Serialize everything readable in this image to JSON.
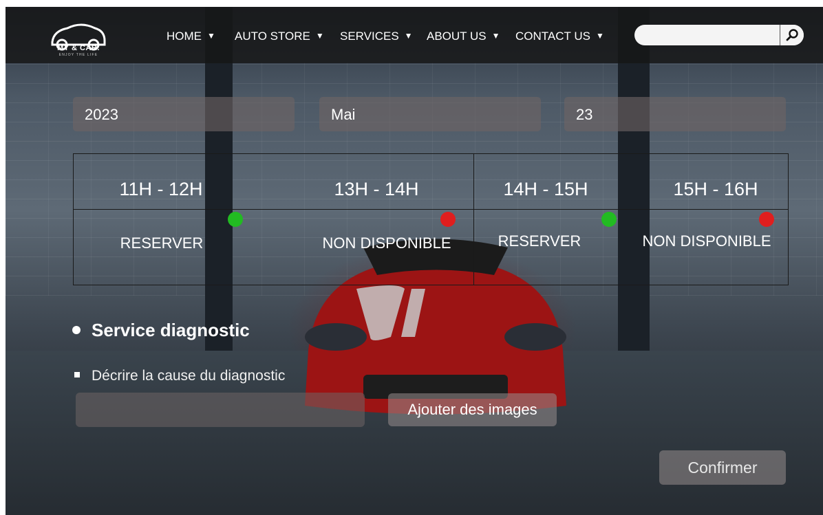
{
  "brand": {
    "name": "MY & CAR.",
    "tagline": "ENJOY THE LIFE"
  },
  "nav": {
    "items": [
      {
        "label": "HOME"
      },
      {
        "label": "AUTO STORE"
      },
      {
        "label": "SERVICES"
      },
      {
        "label": "ABOUT US"
      },
      {
        "label": "CONTACT US"
      }
    ],
    "dropdown_icon": "caret-down-icon"
  },
  "search": {
    "placeholder": "",
    "icon": "search-icon"
  },
  "date": {
    "year": "2023",
    "month": "Mai",
    "day": "23"
  },
  "slots": [
    {
      "time": "11H - 12H",
      "action": "RESERVER",
      "status_color": "#22bb22"
    },
    {
      "time": "13H - 14H",
      "action": "NON DISPONIBLE",
      "status_color": "#e01e1e"
    },
    {
      "time": "14H - 15H",
      "action": "RESERVER",
      "status_color": "#22bb22"
    },
    {
      "time": "15H - 16H",
      "action": "NON DISPONIBLE",
      "status_color": "#e01e1e"
    }
  ],
  "service": {
    "title": "Service diagnostic",
    "description_label": "Décrire la cause du diagnostic",
    "add_images": "Ajouter des images",
    "confirm": "Confirmer"
  }
}
